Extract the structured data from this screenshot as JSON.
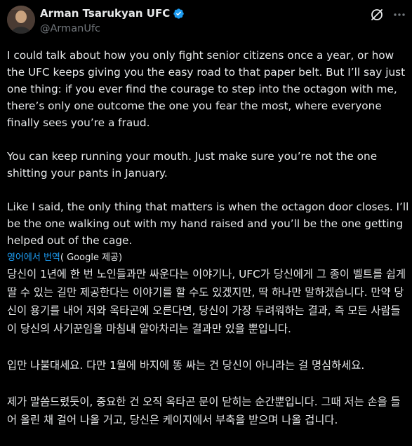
{
  "author": {
    "display_name": "Arman Tsarukyan UFC",
    "handle": "@ArmanUfc",
    "verified": true,
    "verified_color": "#1d9bf0"
  },
  "icons": {
    "avatar": "avatar-photo",
    "verified": "verified-badge-icon",
    "grok": "grok-icon",
    "more": "more-options-icon"
  },
  "tweet": {
    "paragraphs": [
      "I could talk about how you only fight senior citizens once a year, or how the UFC keeps giving you the easy road to that paper belt. But I’ll say just one thing: if you ever find the courage to step into the octagon with me, there’s only one outcome the one you fear the most, where everyone finally sees you’re a fraud.",
      "You can keep running your mouth. Just make sure you’re not the one shitting your pants in January.",
      "Like I said, the only thing that matters is when the octagon door closes. I’ll be the one walking out with my hand raised and you’ll be the one getting helped out of the cage."
    ]
  },
  "translation": {
    "link_label": "영어에서 번역",
    "provider_label": "( Google 제공)",
    "link_color": "#1d9bf0",
    "paragraphs": [
      "당신이 1년에 한 번 노인들과만 싸운다는 이야기나, UFC가 당신에게 그 종이 벨트를 쉽게 딸 수 있는 길만 제공한다는 이야기를 할 수도 있겠지만, 딱 하나만 말하겠습니다. 만약 당신이 용기를 내어 저와 옥타곤에 오른다면, 당신이 가장 두려워하는 결과, 즉 모든 사람들이 당신의 사기꾼임을 마침내 알아차리는 결과만 있을 뿐입니다.",
      "입만 나불대세요. 다만 1월에 바지에 똥 싸는 건 당신이 아니라는 걸 명심하세요.",
      "제가 말씀드렸듯이, 중요한 건 오직 옥타곤 문이 닫히는 순간뿐입니다. 그때 저는 손을 들어 올린 채 걸어 나올 거고, 당신은 케이지에서 부축을 받으며 나올 겁니다."
    ]
  },
  "colors": {
    "background": "#000000",
    "text": "#e7e9ea",
    "secondary_text": "#71767b"
  }
}
